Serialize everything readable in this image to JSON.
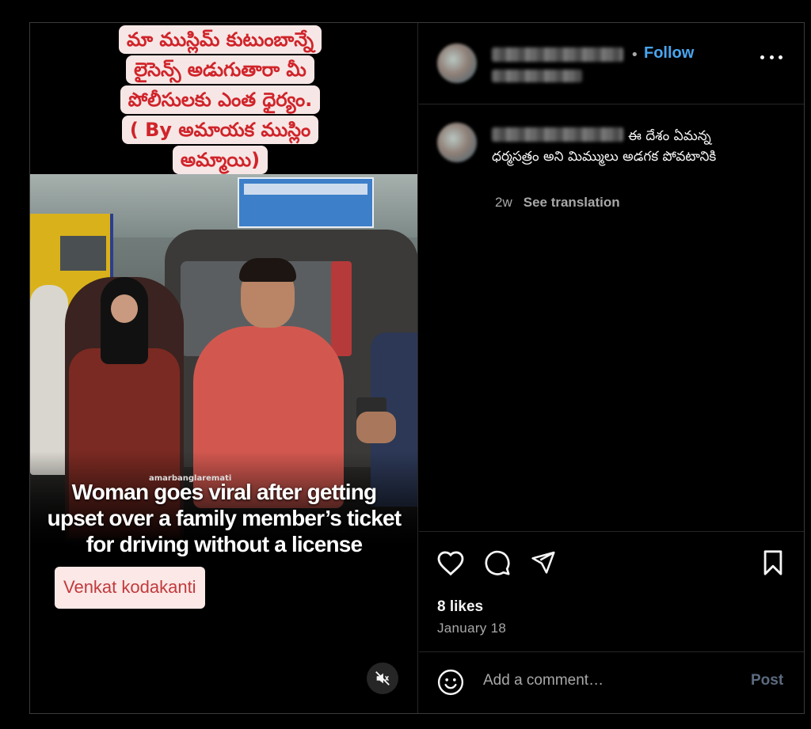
{
  "media": {
    "caption_lines": [
      "మా ముస్లిమ్ కుటుంబాన్నే",
      "లైసెన్స్ అడుగుతారా మీ",
      "పోలీసులకు ఎంత ధైర్యం.",
      "( By అమాయక ముస్లిం",
      "అమ్మాయి)"
    ],
    "watermark": "amarbanglaremati",
    "headline_lines": [
      "Woman goes viral after getting",
      "upset over a family member’s ticket",
      "for driving without a license"
    ],
    "credit": "Venkat kodakanti",
    "mute_icon": "muted-speaker-icon"
  },
  "post": {
    "follow_label": "Follow",
    "more_icon": "more-options-icon",
    "comment": {
      "text": "ఈ దేశం ఏమన్న ధర్మసత్రం అని మిమ్ములు అడగక పోవటానికి",
      "age": "2w",
      "see_translation": "See translation"
    },
    "actions": {
      "like_icon": "heart-icon",
      "comment_icon": "comment-icon",
      "share_icon": "share-icon",
      "save_icon": "bookmark-icon"
    },
    "likes": "8 likes",
    "date": "January 18",
    "add_comment": {
      "placeholder": "Add a comment…",
      "post_label": "Post",
      "emoji_icon": "emoji-icon"
    }
  },
  "colors": {
    "background": "#000000",
    "follow_blue": "#4aa5f0",
    "caption_red": "#d0242a",
    "caption_bg": "#f6e7e6",
    "post_disabled": "#5b6b80"
  }
}
